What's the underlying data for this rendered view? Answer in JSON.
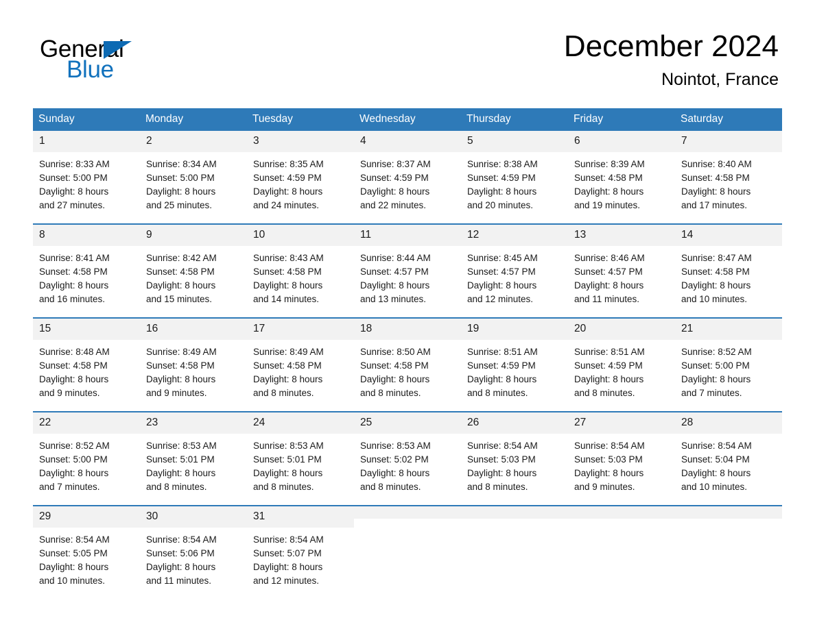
{
  "brand": {
    "logo_text_primary": "General",
    "logo_text_secondary": "Blue",
    "logo_triangle_icon": "triangle-icon",
    "accent_color": "#2e7ab8",
    "logo_blue_color": "#1272bd"
  },
  "header": {
    "title": "December 2024",
    "subtitle": "Nointot, France"
  },
  "calendar": {
    "weekday_headers": [
      "Sunday",
      "Monday",
      "Tuesday",
      "Wednesday",
      "Thursday",
      "Friday",
      "Saturday"
    ],
    "header_bg_color": "#2e7ab8",
    "daynum_bg_color": "#f2f2f2",
    "weeks": [
      [
        {
          "day": "1",
          "sunrise": "Sunrise: 8:33 AM",
          "sunset": "Sunset: 5:00 PM",
          "daylight_1": "Daylight: 8 hours",
          "daylight_2": "and 27 minutes."
        },
        {
          "day": "2",
          "sunrise": "Sunrise: 8:34 AM",
          "sunset": "Sunset: 5:00 PM",
          "daylight_1": "Daylight: 8 hours",
          "daylight_2": "and 25 minutes."
        },
        {
          "day": "3",
          "sunrise": "Sunrise: 8:35 AM",
          "sunset": "Sunset: 4:59 PM",
          "daylight_1": "Daylight: 8 hours",
          "daylight_2": "and 24 minutes."
        },
        {
          "day": "4",
          "sunrise": "Sunrise: 8:37 AM",
          "sunset": "Sunset: 4:59 PM",
          "daylight_1": "Daylight: 8 hours",
          "daylight_2": "and 22 minutes."
        },
        {
          "day": "5",
          "sunrise": "Sunrise: 8:38 AM",
          "sunset": "Sunset: 4:59 PM",
          "daylight_1": "Daylight: 8 hours",
          "daylight_2": "and 20 minutes."
        },
        {
          "day": "6",
          "sunrise": "Sunrise: 8:39 AM",
          "sunset": "Sunset: 4:58 PM",
          "daylight_1": "Daylight: 8 hours",
          "daylight_2": "and 19 minutes."
        },
        {
          "day": "7",
          "sunrise": "Sunrise: 8:40 AM",
          "sunset": "Sunset: 4:58 PM",
          "daylight_1": "Daylight: 8 hours",
          "daylight_2": "and 17 minutes."
        }
      ],
      [
        {
          "day": "8",
          "sunrise": "Sunrise: 8:41 AM",
          "sunset": "Sunset: 4:58 PM",
          "daylight_1": "Daylight: 8 hours",
          "daylight_2": "and 16 minutes."
        },
        {
          "day": "9",
          "sunrise": "Sunrise: 8:42 AM",
          "sunset": "Sunset: 4:58 PM",
          "daylight_1": "Daylight: 8 hours",
          "daylight_2": "and 15 minutes."
        },
        {
          "day": "10",
          "sunrise": "Sunrise: 8:43 AM",
          "sunset": "Sunset: 4:58 PM",
          "daylight_1": "Daylight: 8 hours",
          "daylight_2": "and 14 minutes."
        },
        {
          "day": "11",
          "sunrise": "Sunrise: 8:44 AM",
          "sunset": "Sunset: 4:57 PM",
          "daylight_1": "Daylight: 8 hours",
          "daylight_2": "and 13 minutes."
        },
        {
          "day": "12",
          "sunrise": "Sunrise: 8:45 AM",
          "sunset": "Sunset: 4:57 PM",
          "daylight_1": "Daylight: 8 hours",
          "daylight_2": "and 12 minutes."
        },
        {
          "day": "13",
          "sunrise": "Sunrise: 8:46 AM",
          "sunset": "Sunset: 4:57 PM",
          "daylight_1": "Daylight: 8 hours",
          "daylight_2": "and 11 minutes."
        },
        {
          "day": "14",
          "sunrise": "Sunrise: 8:47 AM",
          "sunset": "Sunset: 4:58 PM",
          "daylight_1": "Daylight: 8 hours",
          "daylight_2": "and 10 minutes."
        }
      ],
      [
        {
          "day": "15",
          "sunrise": "Sunrise: 8:48 AM",
          "sunset": "Sunset: 4:58 PM",
          "daylight_1": "Daylight: 8 hours",
          "daylight_2": "and 9 minutes."
        },
        {
          "day": "16",
          "sunrise": "Sunrise: 8:49 AM",
          "sunset": "Sunset: 4:58 PM",
          "daylight_1": "Daylight: 8 hours",
          "daylight_2": "and 9 minutes."
        },
        {
          "day": "17",
          "sunrise": "Sunrise: 8:49 AM",
          "sunset": "Sunset: 4:58 PM",
          "daylight_1": "Daylight: 8 hours",
          "daylight_2": "and 8 minutes."
        },
        {
          "day": "18",
          "sunrise": "Sunrise: 8:50 AM",
          "sunset": "Sunset: 4:58 PM",
          "daylight_1": "Daylight: 8 hours",
          "daylight_2": "and 8 minutes."
        },
        {
          "day": "19",
          "sunrise": "Sunrise: 8:51 AM",
          "sunset": "Sunset: 4:59 PM",
          "daylight_1": "Daylight: 8 hours",
          "daylight_2": "and 8 minutes."
        },
        {
          "day": "20",
          "sunrise": "Sunrise: 8:51 AM",
          "sunset": "Sunset: 4:59 PM",
          "daylight_1": "Daylight: 8 hours",
          "daylight_2": "and 8 minutes."
        },
        {
          "day": "21",
          "sunrise": "Sunrise: 8:52 AM",
          "sunset": "Sunset: 5:00 PM",
          "daylight_1": "Daylight: 8 hours",
          "daylight_2": "and 7 minutes."
        }
      ],
      [
        {
          "day": "22",
          "sunrise": "Sunrise: 8:52 AM",
          "sunset": "Sunset: 5:00 PM",
          "daylight_1": "Daylight: 8 hours",
          "daylight_2": "and 7 minutes."
        },
        {
          "day": "23",
          "sunrise": "Sunrise: 8:53 AM",
          "sunset": "Sunset: 5:01 PM",
          "daylight_1": "Daylight: 8 hours",
          "daylight_2": "and 8 minutes."
        },
        {
          "day": "24",
          "sunrise": "Sunrise: 8:53 AM",
          "sunset": "Sunset: 5:01 PM",
          "daylight_1": "Daylight: 8 hours",
          "daylight_2": "and 8 minutes."
        },
        {
          "day": "25",
          "sunrise": "Sunrise: 8:53 AM",
          "sunset": "Sunset: 5:02 PM",
          "daylight_1": "Daylight: 8 hours",
          "daylight_2": "and 8 minutes."
        },
        {
          "day": "26",
          "sunrise": "Sunrise: 8:54 AM",
          "sunset": "Sunset: 5:03 PM",
          "daylight_1": "Daylight: 8 hours",
          "daylight_2": "and 8 minutes."
        },
        {
          "day": "27",
          "sunrise": "Sunrise: 8:54 AM",
          "sunset": "Sunset: 5:03 PM",
          "daylight_1": "Daylight: 8 hours",
          "daylight_2": "and 9 minutes."
        },
        {
          "day": "28",
          "sunrise": "Sunrise: 8:54 AM",
          "sunset": "Sunset: 5:04 PM",
          "daylight_1": "Daylight: 8 hours",
          "daylight_2": "and 10 minutes."
        }
      ],
      [
        {
          "day": "29",
          "sunrise": "Sunrise: 8:54 AM",
          "sunset": "Sunset: 5:05 PM",
          "daylight_1": "Daylight: 8 hours",
          "daylight_2": "and 10 minutes."
        },
        {
          "day": "30",
          "sunrise": "Sunrise: 8:54 AM",
          "sunset": "Sunset: 5:06 PM",
          "daylight_1": "Daylight: 8 hours",
          "daylight_2": "and 11 minutes."
        },
        {
          "day": "31",
          "sunrise": "Sunrise: 8:54 AM",
          "sunset": "Sunset: 5:07 PM",
          "daylight_1": "Daylight: 8 hours",
          "daylight_2": "and 12 minutes."
        },
        {
          "day": "",
          "sunrise": "",
          "sunset": "",
          "daylight_1": "",
          "daylight_2": ""
        },
        {
          "day": "",
          "sunrise": "",
          "sunset": "",
          "daylight_1": "",
          "daylight_2": ""
        },
        {
          "day": "",
          "sunrise": "",
          "sunset": "",
          "daylight_1": "",
          "daylight_2": ""
        },
        {
          "day": "",
          "sunrise": "",
          "sunset": "",
          "daylight_1": "",
          "daylight_2": ""
        }
      ]
    ]
  }
}
